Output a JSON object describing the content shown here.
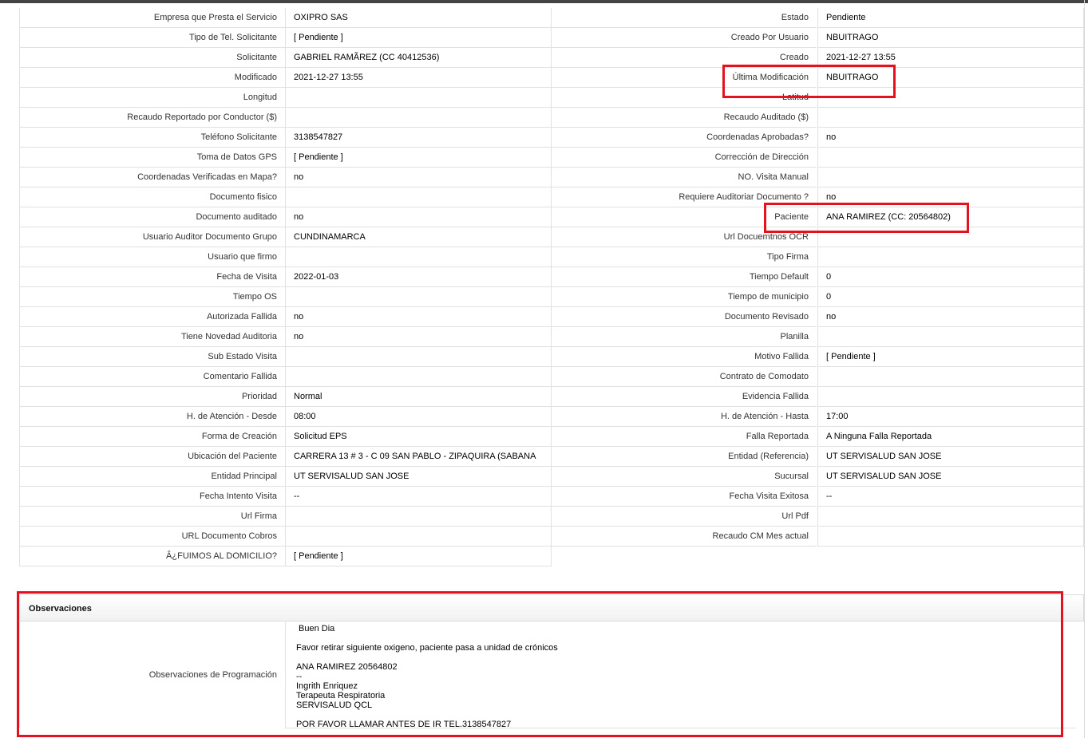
{
  "left_fields": [
    {
      "label": "Empresa que Presta el Servicio",
      "value": "OXIPRO SAS"
    },
    {
      "label": "Tipo de Tel. Solicitante",
      "value": "[ Pendiente ]"
    },
    {
      "label": "Solicitante",
      "value": "GABRIEL RAMÃREZ (CC 40412536)"
    },
    {
      "label": "Modificado",
      "value": "2021-12-27 13:55"
    },
    {
      "label": "Longitud",
      "value": ""
    },
    {
      "label": "Recaudo Reportado por Conductor ($)",
      "value": ""
    },
    {
      "label": "Teléfono Solicitante",
      "value": "3138547827"
    },
    {
      "label": "Toma de Datos GPS",
      "value": "[ Pendiente ]"
    },
    {
      "label": "Coordenadas Verificadas en Mapa?",
      "value": "no"
    },
    {
      "label": "Documento fisico",
      "value": ""
    },
    {
      "label": "Documento auditado",
      "value": "no"
    },
    {
      "label": "Usuario Auditor Documento Grupo",
      "value": "CUNDINAMARCA"
    },
    {
      "label": "Usuario que firmo",
      "value": ""
    },
    {
      "label": "Fecha de Visita",
      "value": "2022-01-03"
    },
    {
      "label": "Tiempo OS",
      "value": ""
    },
    {
      "label": "Autorizada Fallida",
      "value": "no"
    },
    {
      "label": "Tiene Novedad Auditoria",
      "value": "no"
    },
    {
      "label": "Sub Estado Visita",
      "value": ""
    },
    {
      "label": "Comentario Fallida",
      "value": ""
    },
    {
      "label": "Prioridad",
      "value": "Normal"
    },
    {
      "label": "H. de Atención - Desde",
      "value": "08:00"
    },
    {
      "label": "Forma de Creación",
      "value": "Solicitud EPS"
    },
    {
      "label": "Ubicación del Paciente",
      "value": "CARRERA 13 # 3 - C 09 SAN PABLO - ZIPAQUIRA (SABANA"
    },
    {
      "label": "Entidad Principal",
      "value": "UT SERVISALUD SAN JOSE"
    },
    {
      "label": "Fecha Intento Visita",
      "value": "--"
    },
    {
      "label": "Url Firma",
      "value": ""
    },
    {
      "label": "URL Documento Cobros",
      "value": ""
    },
    {
      "label": "Â¿FUIMOS AL DOMICILIO?",
      "value": "[ Pendiente ]"
    }
  ],
  "right_fields": [
    {
      "label": "Estado",
      "value": "Pendiente"
    },
    {
      "label": "Creado Por Usuario",
      "value": "NBUITRAGO"
    },
    {
      "label": "Creado",
      "value": "2021-12-27 13:55"
    },
    {
      "label": "Última Modificación",
      "value": "NBUITRAGO"
    },
    {
      "label": "Latitud",
      "value": ""
    },
    {
      "label": "Recaudo Auditado ($)",
      "value": ""
    },
    {
      "label": "Coordenadas Aprobadas?",
      "value": "no"
    },
    {
      "label": "Corrección de Dirección",
      "value": ""
    },
    {
      "label": "NO. Visita Manual",
      "value": ""
    },
    {
      "label": "Requiere Auditoriar Documento ?",
      "value": "no"
    },
    {
      "label": "Paciente",
      "value": "ANA RAMIREZ (CC: 20564802)"
    },
    {
      "label": "Url Docuemtnos OCR",
      "value": ""
    },
    {
      "label": "Tipo Firma",
      "value": ""
    },
    {
      "label": "Tiempo Default",
      "value": "0"
    },
    {
      "label": "Tiempo de municipio",
      "value": "0"
    },
    {
      "label": "Documento Revisado",
      "value": "no"
    },
    {
      "label": "Planilla",
      "value": ""
    },
    {
      "label": "Motivo Fallida",
      "value": "[ Pendiente ]"
    },
    {
      "label": "Contrato de Comodato",
      "value": ""
    },
    {
      "label": "Evidencia Fallida",
      "value": ""
    },
    {
      "label": "H. de Atención - Hasta",
      "value": "17:00"
    },
    {
      "label": "Falla Reportada",
      "value": "A Ninguna Falla Reportada"
    },
    {
      "label": "Entidad (Referencia)",
      "value": "UT SERVISALUD SAN JOSE"
    },
    {
      "label": "Sucursal",
      "value": "UT SERVISALUD SAN JOSE"
    },
    {
      "label": "Fecha Visita Exitosa",
      "value": "--"
    },
    {
      "label": "Url Pdf",
      "value": ""
    },
    {
      "label": "Recaudo CM Mes actual",
      "value": ""
    }
  ],
  "observaciones": {
    "title": "Observaciones",
    "label": "Observaciones de Programación",
    "lines": [
      "Buen Dia",
      "",
      "Favor retirar siguiente oxigeno, paciente pasa a unidad de crónicos",
      "",
      "ANA RAMIREZ 20564802",
      "--",
      "Ingrith Enriquez",
      "Terapeuta Respiratoria",
      "SERVISALUD QCL",
      "",
      "POR FAVOR LLAMAR ANTES DE IR TEL.3138547827"
    ]
  },
  "highlight_color": "#e3121e"
}
